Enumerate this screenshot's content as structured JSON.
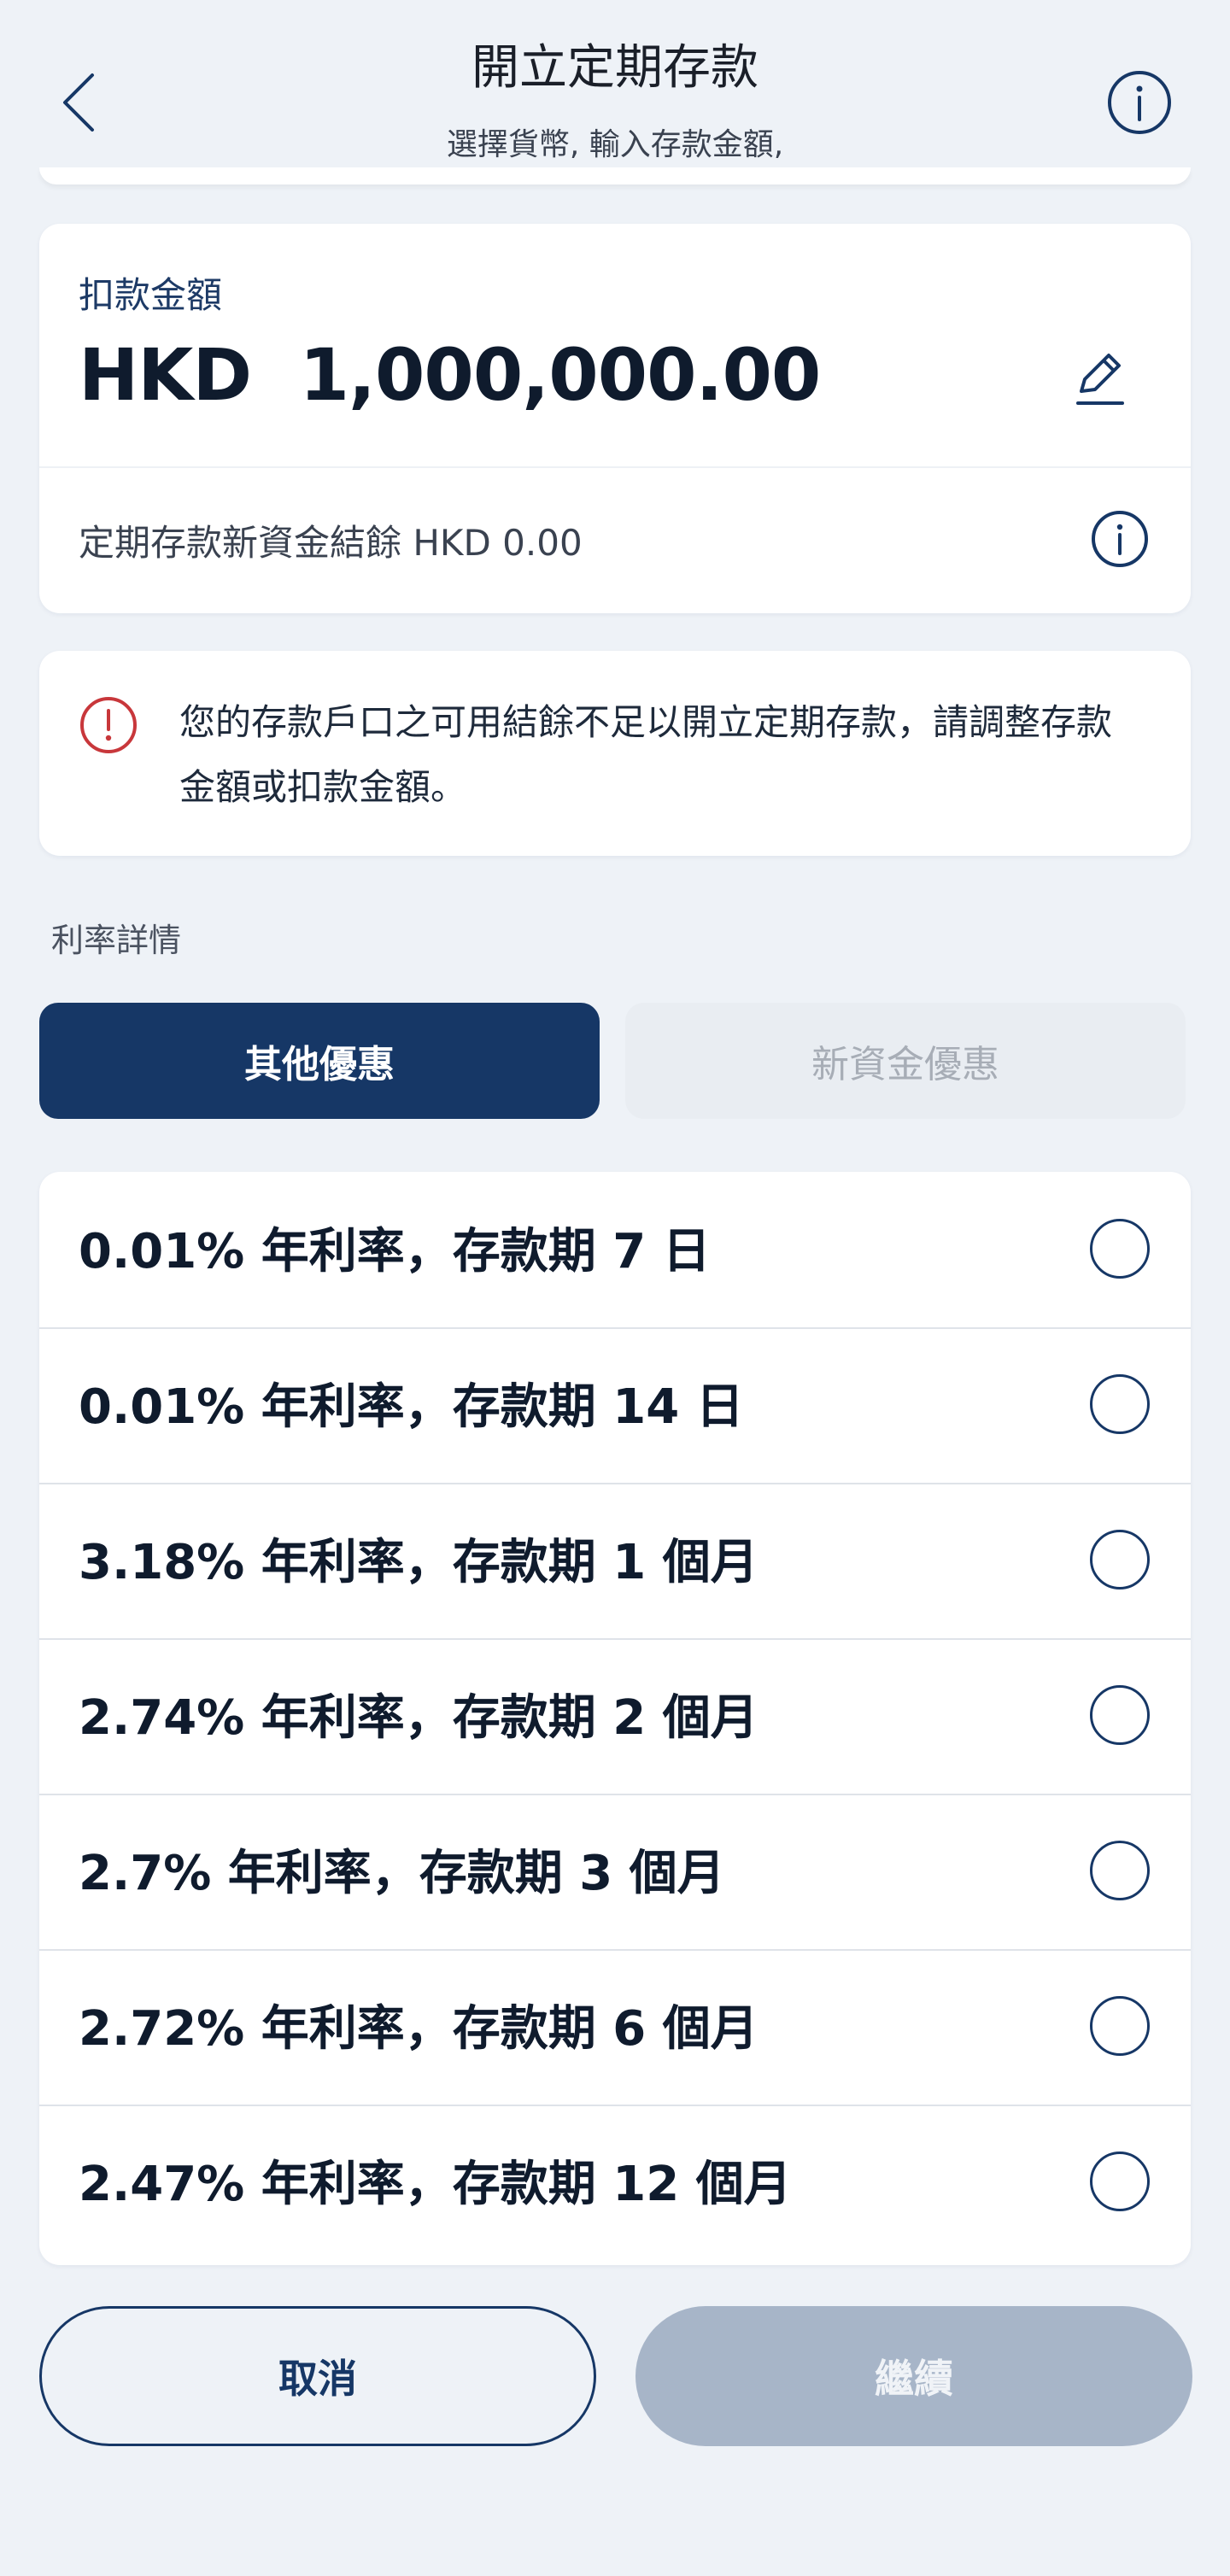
{
  "header": {
    "title": "開立定期存款",
    "subtitle": "選擇貨幣, 輸入存款金額,"
  },
  "amount_card": {
    "label": "扣款金額",
    "amount": "HKD  1,000,000.00",
    "balance_text": "定期存款新資金結餘 HKD 0.00"
  },
  "warning": {
    "text": "您的存款戶口之可用結餘不足以開立定期存款，請調整存款金額或扣款金額。"
  },
  "rate_section": {
    "label": "利率詳情",
    "tabs": [
      {
        "label": "其他優惠",
        "active": true
      },
      {
        "label": "新資金優惠",
        "active": false
      }
    ],
    "options": [
      {
        "label": "0.01% 年利率，存款期 7 日",
        "selected": false
      },
      {
        "label": "0.01% 年利率，存款期 14 日",
        "selected": false
      },
      {
        "label": "3.18% 年利率，存款期 1 個月",
        "selected": false
      },
      {
        "label": "2.74% 年利率，存款期 2 個月",
        "selected": false
      },
      {
        "label": "2.7% 年利率，存款期 3 個月",
        "selected": false
      },
      {
        "label": "2.72% 年利率，存款期 6 個月",
        "selected": false
      },
      {
        "label": "2.47% 年利率，存款期 12 個月",
        "selected": false
      }
    ]
  },
  "buttons": {
    "cancel": "取消",
    "continue": "繼續"
  },
  "colors": {
    "primary": "#163766",
    "background": "#eef2f7",
    "warning": "#c8373b",
    "disabled_button": "#a7b5c8"
  },
  "icons": {
    "back": "chevron-left-icon",
    "info": "info-circle-icon",
    "edit": "pencil-icon",
    "warning": "warning-circle-icon"
  }
}
